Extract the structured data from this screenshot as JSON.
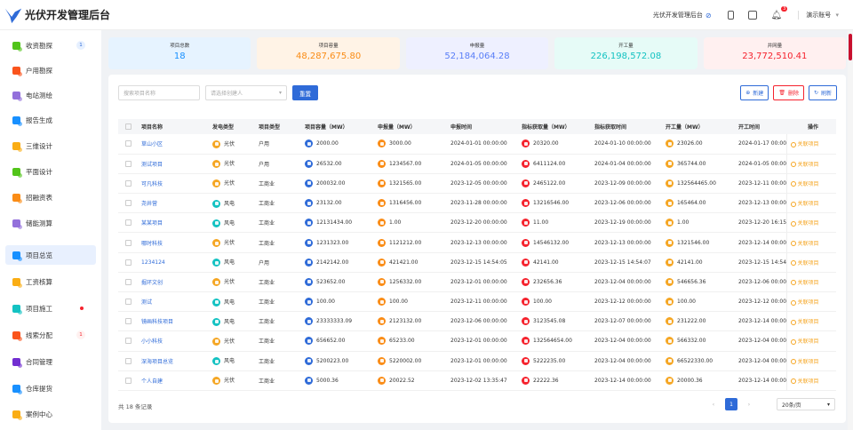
{
  "app": {
    "title": "光伏开发管理后台",
    "logo_icon": "bird-logo"
  },
  "header": {
    "admin_link": "光伏开发管理后台",
    "notification_count": "3",
    "account": "演示账号"
  },
  "sidebar": {
    "items": [
      {
        "label": "收资勘探",
        "icon": "mail-icon",
        "color": "#52c41a",
        "badge": "1",
        "badge_type": "blue"
      },
      {
        "label": "户用勘探",
        "icon": "home-icon",
        "color": "#fa541c"
      },
      {
        "label": "电站测绘",
        "icon": "map-icon",
        "color": "#9370db"
      },
      {
        "label": "报告生成",
        "icon": "report-icon",
        "color": "#1890ff"
      },
      {
        "label": "三维设计",
        "icon": "cube-icon",
        "color": "#faad14"
      },
      {
        "label": "平面设计",
        "icon": "plan-icon",
        "color": "#52c41a"
      },
      {
        "label": "招融资表",
        "icon": "finance-icon",
        "color": "#fa8c16"
      },
      {
        "label": "储能测算",
        "icon": "battery-icon",
        "color": "#9370db"
      },
      {
        "label": "项目总览",
        "icon": "overview-icon",
        "color": "#1890ff",
        "active": true
      },
      {
        "label": "工资核算",
        "icon": "salary-icon",
        "color": "#faad14"
      },
      {
        "label": "项目施工",
        "icon": "construction-icon",
        "color": "#13c2c2",
        "dot": true
      },
      {
        "label": "线索分配",
        "icon": "lead-icon",
        "color": "#fa541c",
        "badge": "1",
        "badge_type": "red"
      },
      {
        "label": "合同管理",
        "icon": "contract-icon",
        "color": "#722ed1"
      },
      {
        "label": "仓库提货",
        "icon": "warehouse-icon",
        "color": "#1890ff"
      },
      {
        "label": "案例中心",
        "icon": "case-icon",
        "color": "#faad14"
      }
    ]
  },
  "stats": [
    {
      "label": "项目总数",
      "value": "18",
      "bg": "#e6f3ff",
      "color": "#1890ff"
    },
    {
      "label": "项目容量",
      "value": "48,287,675.80",
      "bg": "#fff3e6",
      "color": "#fa8c16"
    },
    {
      "label": "申报量",
      "value": "52,184,064.28",
      "bg": "#eef0ff",
      "color": "#597ef7"
    },
    {
      "label": "开工量",
      "value": "226,198,572.08",
      "bg": "#e6fbf7",
      "color": "#13c2c2"
    },
    {
      "label": "并网量",
      "value": "23,772,510.41",
      "bg": "#fff0f0",
      "color": "#f5222d"
    }
  ],
  "filters": {
    "search_placeholder": "搜索项目名称",
    "creator_placeholder": "请选择创建人",
    "reset": "重置"
  },
  "actions": {
    "create": "新建",
    "delete": "删除",
    "refresh": "刷新"
  },
  "table": {
    "headers": [
      "项目名称",
      "发电类型",
      "项目类型",
      "项目容量（MW）",
      "申报量（MW）",
      "申报时间",
      "指标获取量（MW）",
      "指标获取时间",
      "开工量（MW）",
      "开工时间",
      "操作"
    ],
    "op_label": "关联项目",
    "rows": [
      {
        "name": "草山小区",
        "gen": "光伏",
        "type": "户用",
        "cap": "2000.00",
        "decl": "3000.00",
        "decl_time": "2024-01-01 00:00:00",
        "idx": "20320.00",
        "idx_time": "2024-01-10 00:00:00",
        "start": "23026.00",
        "start_time": "2024-01-17 00:00:0"
      },
      {
        "name": "测试项目",
        "gen": "光伏",
        "type": "户用",
        "cap": "26532.00",
        "decl": "1234567.00",
        "decl_time": "2024-01-05 00:00:00",
        "idx": "6411124.00",
        "idx_time": "2024-01-04 00:00:00",
        "start": "365744.00",
        "start_time": "2024-01-05 00:00:0"
      },
      {
        "name": "可凡科技",
        "gen": "光伏",
        "type": "工商业",
        "cap": "200032.00",
        "decl": "1321565.00",
        "decl_time": "2023-12-05 00:00:00",
        "idx": "2465122.00",
        "idx_time": "2023-12-09 00:00:00",
        "start": "132564465.00",
        "start_time": "2023-12-11 00:00:0"
      },
      {
        "name": "尧井营",
        "gen": "风电",
        "type": "工商业",
        "cap": "23132.00",
        "decl": "1316456.00",
        "decl_time": "2023-11-28 00:00:00",
        "idx": "13216546.00",
        "idx_time": "2023-12-06 00:00:00",
        "start": "165464.00",
        "start_time": "2023-12-13 00:00:0"
      },
      {
        "name": "某某项目",
        "gen": "风电",
        "type": "工商业",
        "cap": "12131434.00",
        "decl": "1.00",
        "decl_time": "2023-12-20 00:00:00",
        "idx": "11.00",
        "idx_time": "2023-12-19 00:00:00",
        "start": "1.00",
        "start_time": "2023-12-20 16:15:"
      },
      {
        "name": "哪时科技",
        "gen": "光伏",
        "type": "工商业",
        "cap": "1231323.00",
        "decl": "1121212.00",
        "decl_time": "2023-12-13 00:00:00",
        "idx": "14546132.00",
        "idx_time": "2023-12-13 00:00:00",
        "start": "1321546.00",
        "start_time": "2023-12-14 00:00:0"
      },
      {
        "name": "1234124",
        "gen": "风电",
        "type": "户用",
        "cap": "2142142.00",
        "decl": "421421.00",
        "decl_time": "2023-12-15 14:54:05",
        "idx": "42141.00",
        "idx_time": "2023-12-15 14:54:07",
        "start": "42141.00",
        "start_time": "2023-12-15 14:54:"
      },
      {
        "name": "掘环文创",
        "gen": "光伏",
        "type": "工商业",
        "cap": "523652.00",
        "decl": "1256332.00",
        "decl_time": "2023-12-01 00:00:00",
        "idx": "232656.36",
        "idx_time": "2023-12-04 00:00:00",
        "start": "546656.36",
        "start_time": "2023-12-06 00:00:0"
      },
      {
        "name": "测试",
        "gen": "风电",
        "type": "工商业",
        "cap": "100.00",
        "decl": "100.00",
        "decl_time": "2023-12-11 00:00:00",
        "idx": "100.00",
        "idx_time": "2023-12-12 00:00:00",
        "start": "100.00",
        "start_time": "2023-12-12 00:00:0"
      },
      {
        "name": "镜画科技项目",
        "gen": "风电",
        "type": "工商业",
        "cap": "23333333.09",
        "decl": "2123132.00",
        "decl_time": "2023-12-06 00:00:00",
        "idx": "3123545.08",
        "idx_time": "2023-12-07 00:00:00",
        "start": "231222.00",
        "start_time": "2023-12-14 00:00:0"
      },
      {
        "name": "小小科技",
        "gen": "光伏",
        "type": "工商业",
        "cap": "656652.00",
        "decl": "65233.00",
        "decl_time": "2023-12-01 00:00:00",
        "idx": "132564654.00",
        "idx_time": "2023-12-04 00:00:00",
        "start": "566332.00",
        "start_time": "2023-12-04 00:00:0"
      },
      {
        "name": "深海项目总览",
        "gen": "风电",
        "type": "工商业",
        "cap": "5200223.00",
        "decl": "5220002.00",
        "decl_time": "2023-12-01 00:00:00",
        "idx": "5222235.00",
        "idx_time": "2023-12-04 00:00:00",
        "start": "66522330.00",
        "start_time": "2023-12-04 00:00:0"
      },
      {
        "name": "个人自建",
        "gen": "光伏",
        "type": "工商业",
        "cap": "5000.36",
        "decl": "20022.52",
        "decl_time": "2023-12-02 13:35:47",
        "idx": "22222.36",
        "idx_time": "2023-12-14 00:00:00",
        "start": "20000.36",
        "start_time": "2023-12-14 00:00:0"
      }
    ]
  },
  "footer": {
    "total": "共 18 条记录",
    "current_page": "1",
    "page_size": "20条/页"
  }
}
